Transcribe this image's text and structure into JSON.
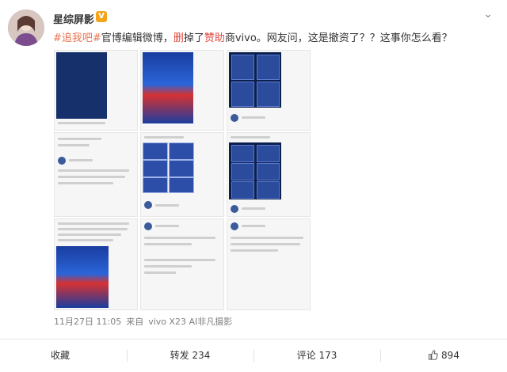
{
  "author": {
    "name": "星综屏影",
    "badge": "V"
  },
  "post": {
    "tag1": "#追我吧#",
    "text1": "官博编辑微博，",
    "del_word": "删",
    "text2": "掉了",
    "sponsor_word": "赞助",
    "text3": "商vivo。网友问，这是撤资了？？这事你怎么看？"
  },
  "meta": {
    "date": "11月27日 11:05",
    "source_prefix": "来自",
    "source": "vivo X23 AI非凡摄影"
  },
  "actions": {
    "favorite": "收藏",
    "repost": "转发 234",
    "comment": "评论 173",
    "like": "894"
  },
  "colors": {
    "tag": "#eb7350",
    "red": "#e0473d",
    "badge": "#f4a41b"
  }
}
